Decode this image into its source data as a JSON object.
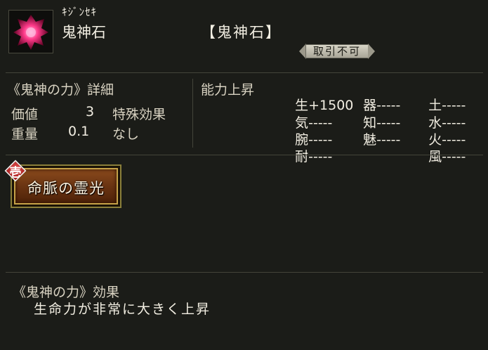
{
  "item": {
    "furigana": "ｷｼﾞﾝｾｷ",
    "name": "鬼神石",
    "title": "【鬼神石】",
    "trade_status": "取引不可"
  },
  "details": {
    "header": "《鬼神の力》詳細",
    "value_label": "価値",
    "value": "3",
    "weight_label": "重量",
    "weight": "0.1",
    "special_label": "特殊効果",
    "special_value": "なし"
  },
  "ability": {
    "header": "能力上昇",
    "stats": [
      {
        "label": "生",
        "value": "+1500"
      },
      {
        "label": "気",
        "value": "-----"
      },
      {
        "label": "腕",
        "value": "-----"
      },
      {
        "label": "耐",
        "value": "-----"
      },
      {
        "label": "器",
        "value": "-----"
      },
      {
        "label": "知",
        "value": "-----"
      },
      {
        "label": "魅",
        "value": "-----"
      },
      {
        "label": "土",
        "value": "-----"
      },
      {
        "label": "水",
        "value": "-----"
      },
      {
        "label": "火",
        "value": "-----"
      },
      {
        "label": "風",
        "value": "-----"
      }
    ]
  },
  "skill": {
    "rank": "壱",
    "name": "命脈の霊光"
  },
  "effect": {
    "title": "《鬼神の力》効果",
    "description": "生命力が非常に大きく上昇"
  },
  "colors": {
    "background": "#1b1c18",
    "text": "#f2eee2",
    "skill_plate": "#6a3412",
    "skill_border": "#c6a248",
    "rank_badge": "#b02020"
  }
}
